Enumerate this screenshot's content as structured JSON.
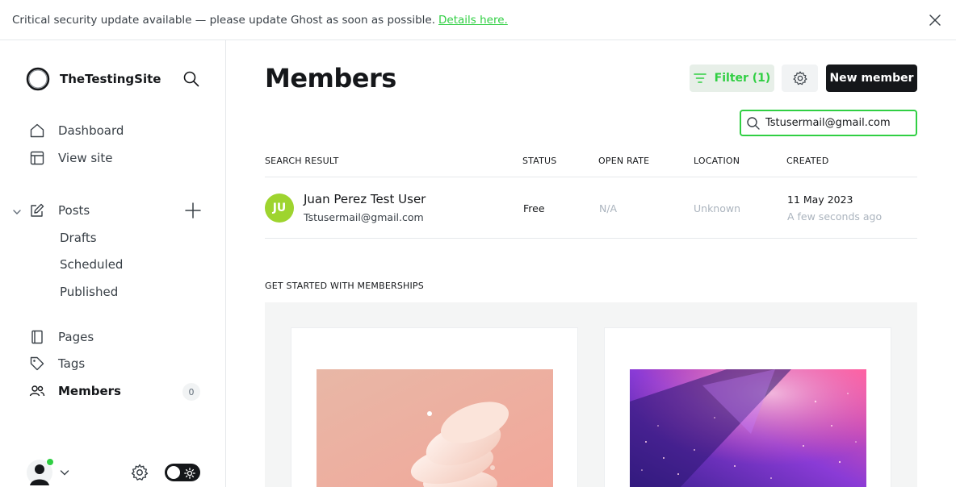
{
  "banner": {
    "message": "Critical security update available — please update Ghost as soon as possible.",
    "link": "Details here."
  },
  "sidebar": {
    "site_name": "TheTestingSite",
    "nav": {
      "dashboard": "Dashboard",
      "view_site": "View site",
      "posts": "Posts",
      "drafts": "Drafts",
      "scheduled": "Scheduled",
      "published": "Published",
      "pages": "Pages",
      "tags": "Tags",
      "members": "Members"
    },
    "members_count": "0"
  },
  "main": {
    "title": "Members",
    "filter_label": "Filter (1)",
    "new_member_label": "New member",
    "search_value": "Tstusermail@gmail.com",
    "columns": {
      "search_result": "SEARCH RESULT",
      "status": "STATUS",
      "open_rate": "OPEN RATE",
      "location": "LOCATION",
      "created": "CREATED"
    },
    "rows": [
      {
        "initials": "JU",
        "name": "Juan Perez Test User",
        "email": "Tstusermail@gmail.com",
        "status": "Free",
        "open_rate": "N/A",
        "location": "Unknown",
        "created_date": "11 May 2023",
        "created_relative": "A few seconds ago"
      }
    ],
    "get_started_heading": "GET STARTED WITH MEMBERSHIPS"
  },
  "colors": {
    "accent": "#30cf43",
    "avatar": "#9ed42f",
    "dark": "#15171a"
  }
}
